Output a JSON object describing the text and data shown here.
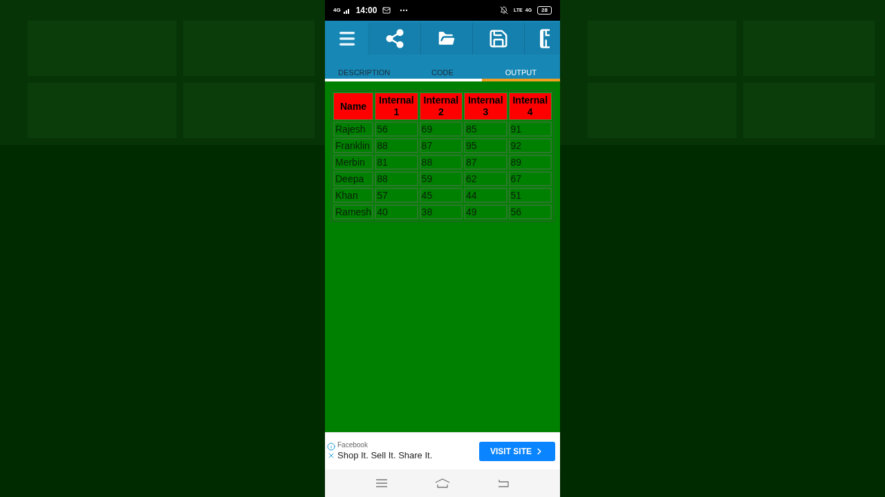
{
  "status_bar": {
    "network": "4G",
    "time": "14:00",
    "volte": "LTE",
    "data": "4G",
    "battery": "28"
  },
  "tabs": [
    {
      "label": "DESCRIPTION",
      "selected": false
    },
    {
      "label": "CODE",
      "selected": false
    },
    {
      "label": "OUTPUT",
      "selected": true
    }
  ],
  "table": {
    "columns": [
      "Name",
      "Internal 1",
      "Internal 2",
      "Internal 3",
      "Internal 4"
    ],
    "rows": [
      [
        "Rajesh",
        "56",
        "69",
        "85",
        "91"
      ],
      [
        "Franklin",
        "88",
        "87",
        "95",
        "92"
      ],
      [
        "Merbin",
        "81",
        "88",
        "87",
        "89"
      ],
      [
        "Deepa",
        "88",
        "59",
        "62",
        "67"
      ],
      [
        "Khan",
        "57",
        "45",
        "44",
        "51"
      ],
      [
        "Ramesh",
        "40",
        "38",
        "49",
        "56"
      ]
    ]
  },
  "ad": {
    "advertiser": "Facebook",
    "headline": "Shop It. Sell It. Share It.",
    "button": "VISIT SITE"
  }
}
